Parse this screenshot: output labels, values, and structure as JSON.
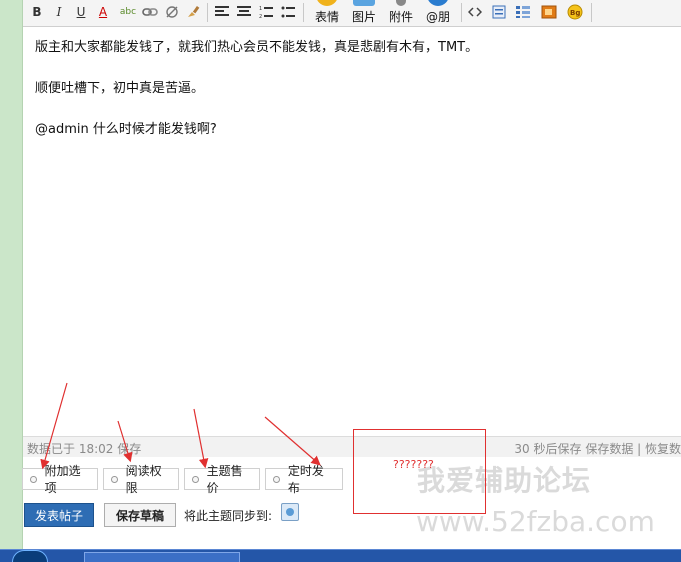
{
  "toolbar": {
    "buttons": [
      {
        "name": "bold",
        "glyph": "B"
      },
      {
        "name": "italic",
        "glyph": "I"
      },
      {
        "name": "underline",
        "glyph": "U"
      },
      {
        "name": "font-color",
        "glyph": "A"
      },
      {
        "name": "spellcheck",
        "glyph": "abc"
      }
    ],
    "big": [
      {
        "label": "表情",
        "color": "#f0b21b"
      },
      {
        "label": "图片",
        "color": "#5aa4e0"
      },
      {
        "label": "附件",
        "color": "#888888"
      },
      {
        "label": "@朋",
        "color": "#2a7ccf"
      }
    ]
  },
  "editor": {
    "lines": [
      "版主和大家都能发钱了，就我们热心会员不能发钱，真是悲剧有木有，TMT。",
      "顺便吐槽下，初中真是苦逼。",
      "@admin 什么时候才能发钱啊?"
    ]
  },
  "status": {
    "left": "数据已于 18:02 保存",
    "right": "30 秒后保存 保存数据 | 恢复数"
  },
  "options": [
    {
      "label": "附加选项"
    },
    {
      "label": "阅读权限"
    },
    {
      "label": "主题售价"
    },
    {
      "label": "定时发布"
    }
  ],
  "actions": {
    "post_label": "发表帖子",
    "draft_label": "保存草稿",
    "sync_label": "将此主题同步到:"
  },
  "annotation": {
    "question_text": "???????",
    "color": "#e03030"
  },
  "watermark": {
    "line1": "我爱辅助论坛",
    "line2": "www.52fzba.com"
  }
}
